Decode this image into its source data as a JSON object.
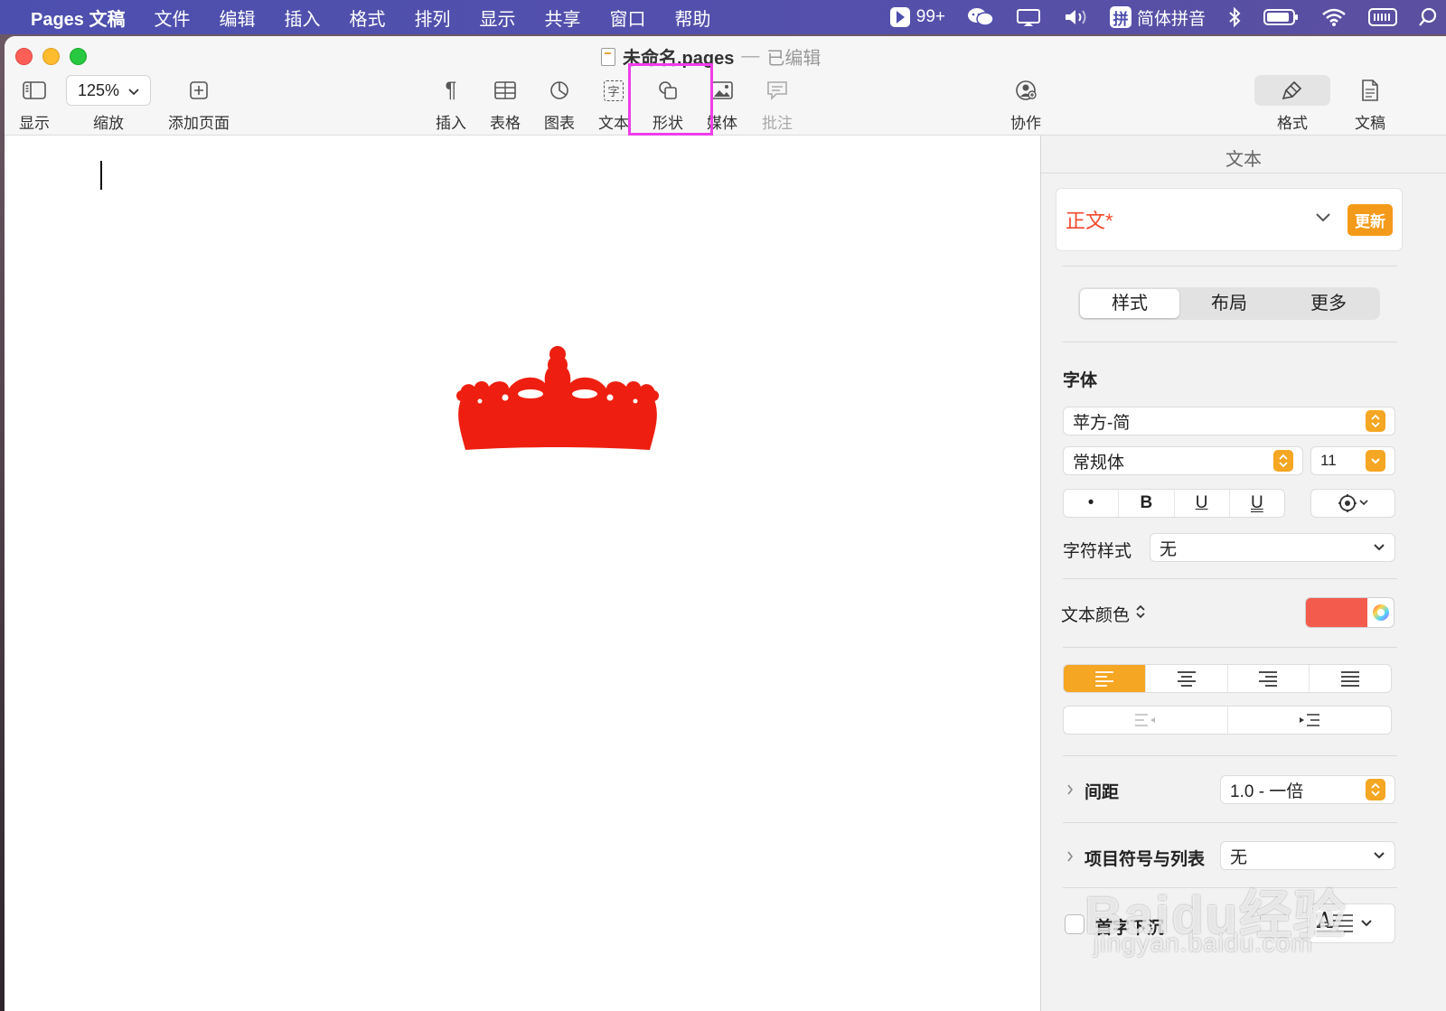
{
  "menubar": {
    "app": "Pages 文稿",
    "items": [
      "文件",
      "编辑",
      "插入",
      "格式",
      "排列",
      "显示",
      "共享",
      "窗口",
      "帮助"
    ],
    "status": {
      "badge": "99+",
      "input_method": "简体拼音",
      "input_method_glyph": "拼"
    }
  },
  "window": {
    "title": "未命名.pages",
    "title_sep": "—",
    "title_state": "已编辑"
  },
  "toolbar": {
    "view_label": "显示",
    "zoom_value": "125%",
    "zoom_label": "缩放",
    "add_page_label": "添加页面",
    "insert_label": "插入",
    "table_label": "表格",
    "chart_label": "图表",
    "text_label": "文本",
    "text_icon_glyph": "字",
    "shape_label": "形状",
    "media_label": "媒体",
    "comment_label": "批注",
    "collab_label": "协作",
    "format_label": "格式",
    "document_label": "文稿"
  },
  "canvas": {
    "shape_color": "#ee1f10"
  },
  "inspector": {
    "title": "文本",
    "paragraph_style": "正文*",
    "update_button": "更新",
    "tabs": [
      "样式",
      "布局",
      "更多"
    ],
    "font_section": "字体",
    "font_family": "苹方-简",
    "font_weight": "常规体",
    "font_size": "11",
    "style_buttons": [
      "•",
      "B",
      "U",
      "U"
    ],
    "char_style_label": "字符样式",
    "char_style_value": "无",
    "text_color_label": "文本颜色",
    "text_color": "#f35c4c",
    "spacing_label": "间距",
    "spacing_value": "1.0 - 一倍",
    "bullets_label": "项目符号与列表",
    "bullets_value": "无",
    "dropcap_label": "首字下沉",
    "dropcap_glyph": "A"
  },
  "watermark": {
    "main": "Baidu经验",
    "sub": "jingyan.baidu.com"
  }
}
